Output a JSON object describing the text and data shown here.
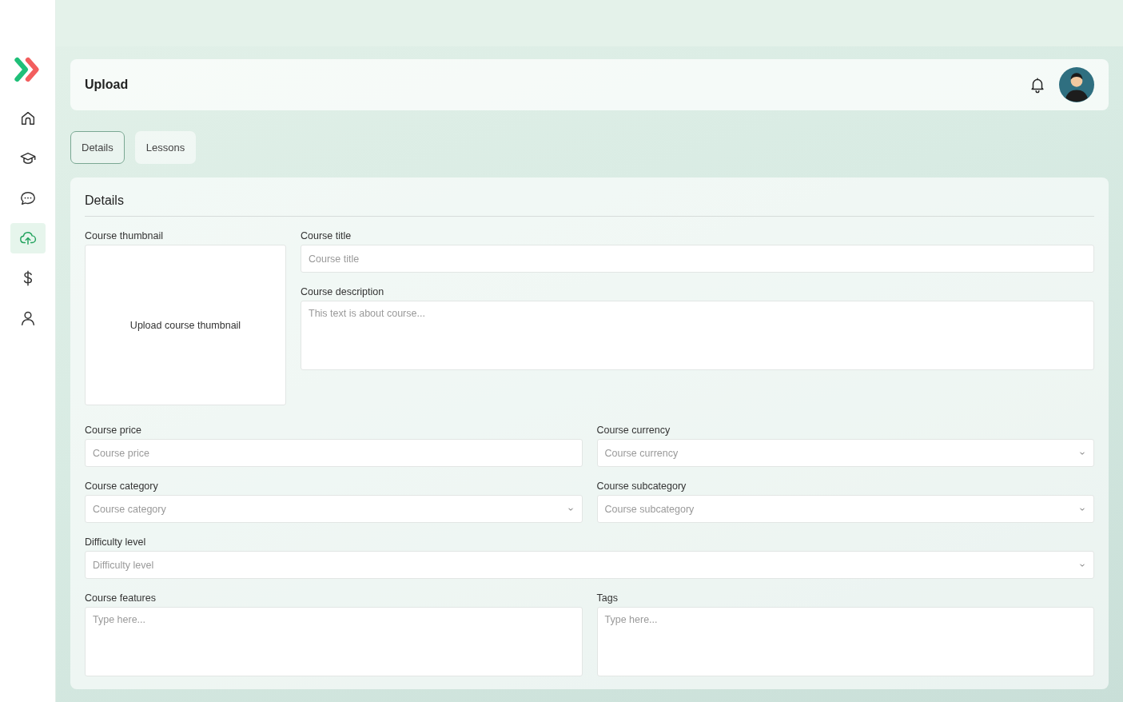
{
  "sidebar": {
    "items": [
      {
        "kind": "home",
        "selected": false
      },
      {
        "kind": "courses",
        "selected": false
      },
      {
        "kind": "chat",
        "selected": false
      },
      {
        "kind": "upload",
        "selected": true
      },
      {
        "kind": "dollar",
        "selected": false
      },
      {
        "kind": "user",
        "selected": false
      }
    ]
  },
  "header": {
    "title": "Upload"
  },
  "tabs": [
    {
      "label": "Details",
      "selected": true
    },
    {
      "label": "Lessons",
      "selected": false
    }
  ],
  "details": {
    "title": "Details",
    "thumbnail": {
      "label": "Course thumbnail",
      "prompt": "Upload course thumbnail"
    },
    "top_fields": [
      {
        "label": "Course title",
        "kind": "text",
        "placeholder": "Course title"
      },
      {
        "label": "Course description",
        "kind": "textarea",
        "placeholder": "This text is about course..."
      }
    ],
    "fields": [
      {
        "label": "Course price",
        "kind": "text",
        "placeholder": "Course price",
        "wide": false
      },
      {
        "label": "Course currency",
        "kind": "select",
        "placeholder": "Course currency",
        "wide": false
      },
      {
        "label": "Course category",
        "kind": "select",
        "placeholder": "Course category",
        "wide": false
      },
      {
        "label": "Course subcategory",
        "kind": "select",
        "placeholder": "Course subcategory",
        "wide": false
      },
      {
        "label": "Difficulty level",
        "kind": "select",
        "placeholder": "Difficulty level",
        "wide": true
      },
      {
        "label": "Course features",
        "kind": "textarea",
        "placeholder": "Type here...",
        "wide": false
      },
      {
        "label": "Tags",
        "kind": "textarea",
        "placeholder": "Type here...",
        "wide": false
      }
    ]
  }
}
